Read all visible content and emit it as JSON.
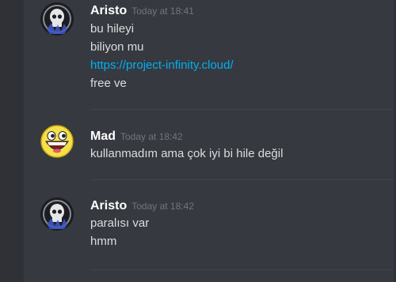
{
  "messages": [
    {
      "author": "Aristo",
      "timestamp": "Today at 18:41",
      "avatar_icon": "skull-avatar-icon",
      "lines": [
        "bu hileyi",
        "biliyon mu",
        "https://project-infinity.cloud/",
        "free ve"
      ]
    },
    {
      "author": "Mad",
      "timestamp": "Today at 18:42",
      "avatar_icon": "awesome-face-avatar-icon",
      "lines": [
        "kullanmadım ama çok iyi bi hile değil"
      ]
    },
    {
      "author": "Aristo",
      "timestamp": "Today at 18:42",
      "avatar_icon": "skull-avatar-icon",
      "lines": [
        "paralısı var",
        "hmm"
      ]
    }
  ],
  "colors": {
    "background": "#36393f",
    "author": "#ffffff",
    "timestamp": "#72767d",
    "text": "#dcddde",
    "link": "#00b0f4"
  }
}
